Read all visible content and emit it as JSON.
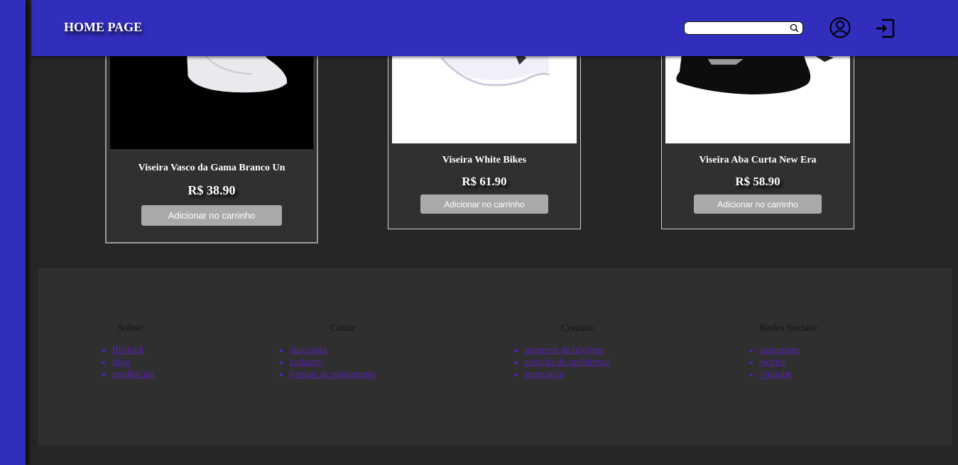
{
  "header": {
    "title": "HOME PAGE",
    "search_placeholder": "",
    "icons": {
      "search": "search-icon",
      "user": "user-circle-icon",
      "login": "login-icon"
    }
  },
  "products": [
    {
      "name": "Viseira Vasco da Gama Branco Un",
      "price": "R$ 38.90",
      "button": "Adicionar no carrinho"
    },
    {
      "name": "Viseira White Bikes",
      "price": "R$ 61.90",
      "button": "Adicionar no carrinho"
    },
    {
      "name": "Viseira Aba Curta New Era",
      "price": "R$ 58.90",
      "button": "Adicionar no carrinho"
    }
  ],
  "footer": {
    "columns": [
      {
        "title": "Sobre:",
        "links": [
          "flit-lock",
          "blog",
          "tendências"
        ]
      },
      {
        "title": "Conta:",
        "links": [
          "sua conta",
          "cadastro",
          "formas de pagamento"
        ]
      },
      {
        "title": "Contato:",
        "links": [
          "numeros de telefone",
          "solução de problemas",
          "segurança"
        ]
      },
      {
        "title": "Redes Sociais:",
        "links": [
          "instagram",
          "twitter",
          "youtube"
        ]
      }
    ]
  },
  "colors": {
    "brand": "#312dbd",
    "background": "#262626",
    "card": "#303030",
    "button": "#a9a9a9",
    "link": "#5a1fb5"
  }
}
